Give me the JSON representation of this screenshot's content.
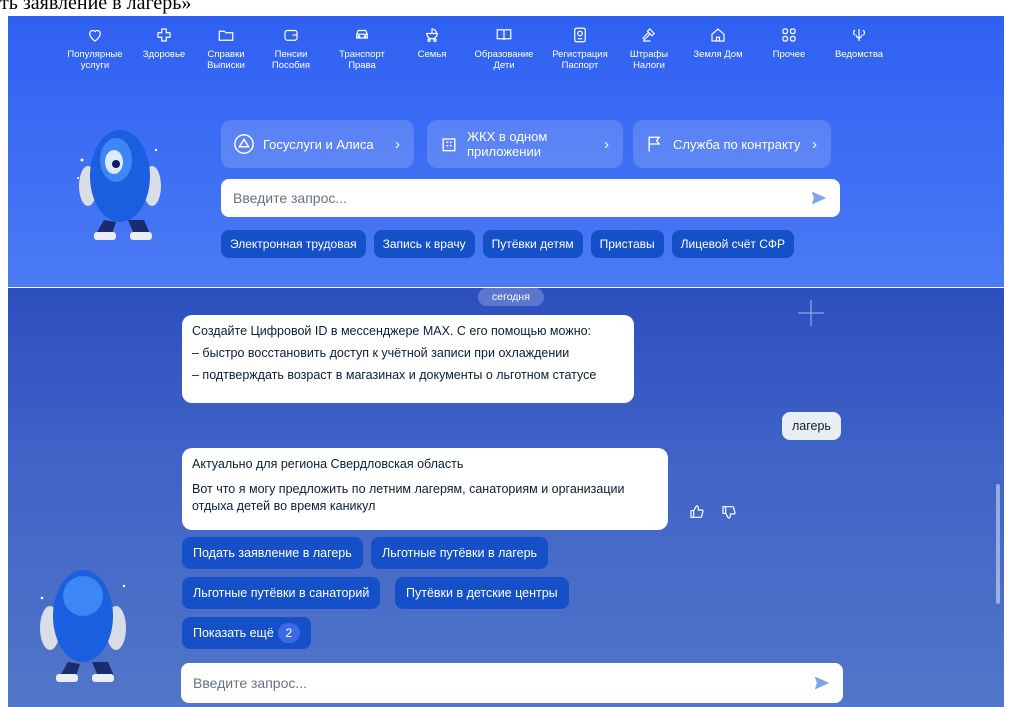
{
  "doc_caption": "ть заявление в лагерь»",
  "nav": [
    {
      "icon": "heart-icon",
      "label": "Популярные\nуслуги"
    },
    {
      "icon": "health-cross-icon",
      "label": "Здоровье"
    },
    {
      "icon": "folder-icon",
      "label": "Справки\nВыписки"
    },
    {
      "icon": "wallet-icon",
      "label": "Пенсии\nПособия"
    },
    {
      "icon": "car-icon",
      "label": "Транспорт\nПрава"
    },
    {
      "icon": "stroller-icon",
      "label": "Семья"
    },
    {
      "icon": "book-icon",
      "label": "Образование\nДети"
    },
    {
      "icon": "passport-icon",
      "label": "Регистрация\nПаспорт"
    },
    {
      "icon": "gavel-icon",
      "label": "Штрафы\nНалоги"
    },
    {
      "icon": "house-icon",
      "label": "Земля Дом"
    },
    {
      "icon": "grid-icon",
      "label": "Прочее"
    },
    {
      "icon": "emblem-icon",
      "label": "Ведомства"
    }
  ],
  "promos": [
    {
      "label": "Госуслуги и Алиса",
      "icon": "alice-icon"
    },
    {
      "label": "ЖКХ в одном приложении",
      "icon": "building-icon"
    },
    {
      "label": "Служба по контракту",
      "icon": "flag-icon"
    }
  ],
  "search": {
    "placeholder": "Введите запрос..."
  },
  "quick_chips": [
    "Электронная трудовая",
    "Запись к врачу",
    "Путёвки детям",
    "Приставы",
    "Лицевой счёт СФР"
  ],
  "chat": {
    "date_label": "сегодня",
    "bot_message_1": {
      "line1": "Создайте Цифровой ID в мессенджере MAX. С его помощью можно:",
      "line2": "– быстро восстановить доступ к учётной записи при охлаждении",
      "line3": "– подтверждать возраст в магазинах и документы о льготном статусе"
    },
    "user_message": "лагерь",
    "bot_message_2": {
      "line1": "Актуально для региона Свердловская область",
      "line2": "Вот что я могу предложить по летним лагерям, санаториям и организации отдыха детей во время каникул"
    },
    "suggestions": [
      "Подать заявление в лагерь",
      "Льготные путёвки в лагерь",
      "Льготные путёвки в санаторий",
      "Путёвки в детские центры"
    ],
    "show_more_label": "Показать ещё",
    "show_more_count": "2",
    "input_placeholder": "Введите запрос..."
  },
  "colors": {
    "panel_top": "#2f60f2",
    "chip": "#1550c9",
    "panel_bottom": "#3f63c7",
    "send_icon": "#7fa3e6"
  }
}
